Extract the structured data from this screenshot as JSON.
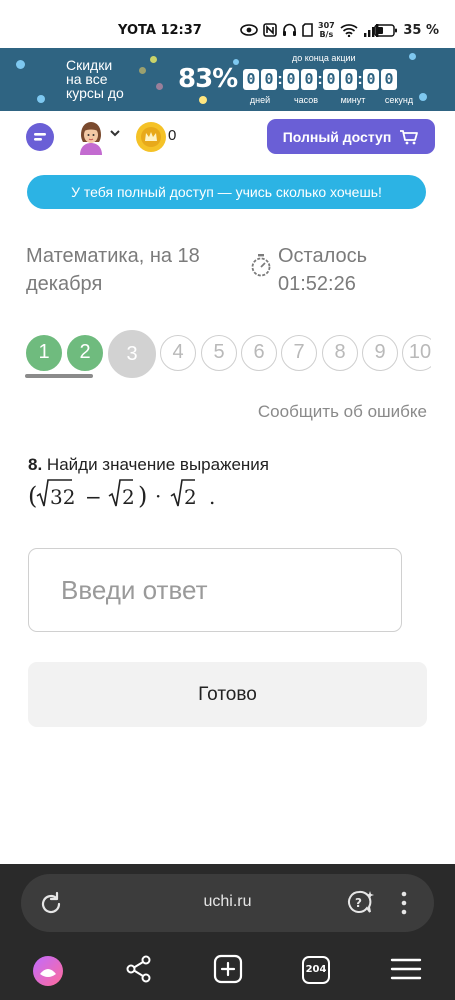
{
  "status_bar": {
    "carrier_time": "YOTA 12:37",
    "net_speed_value": "307",
    "net_speed_unit": "B/s",
    "battery": "35 %"
  },
  "promo": {
    "text_lines": [
      "Скидки",
      "на все",
      "курсы до"
    ],
    "percent": "83%",
    "until_label": "до конца акции",
    "timer": [
      {
        "digits": [
          "0",
          "0"
        ],
        "label": "дней"
      },
      {
        "digits": [
          "0",
          "0"
        ],
        "label": "часов"
      },
      {
        "digits": [
          "0",
          "0"
        ],
        "label": "минут"
      },
      {
        "digits": [
          "0",
          "0"
        ],
        "label": "секунд"
      }
    ]
  },
  "header": {
    "crown_count": "0",
    "full_access_label": "Полный доступ"
  },
  "info_message": "У тебя полный доступ — учись сколько хочешь!",
  "test": {
    "title": "Математика, на 18 декабря",
    "remaining_label": "Осталось",
    "remaining_time": "01:52:26"
  },
  "questions": [
    {
      "label": "1",
      "state": "done"
    },
    {
      "label": "2",
      "state": "done"
    },
    {
      "label": "3",
      "state": "current"
    },
    {
      "label": "4",
      "state": "pending"
    },
    {
      "label": "5",
      "state": "pending"
    },
    {
      "label": "6",
      "state": "pending"
    },
    {
      "label": "7",
      "state": "pending"
    },
    {
      "label": "8",
      "state": "pending"
    },
    {
      "label": "9",
      "state": "pending"
    },
    {
      "label": "10",
      "state": "pending"
    }
  ],
  "report_error": "Сообщить об ошибке",
  "question": {
    "number": "8.",
    "text": "Найди значение выражения",
    "formula": {
      "open_paren": "(",
      "radicand_a": "32",
      "minus": "−",
      "radicand_b": "2",
      "close_paren": ")",
      "times": "·",
      "radicand_c": "2",
      "period": "."
    }
  },
  "answer": {
    "placeholder": "Введи ответ",
    "value": ""
  },
  "done_label": "Готово",
  "browser": {
    "url": "uchi.ru",
    "tabs_count": "204"
  },
  "colors": {
    "brand_purple": "#6a5fd6",
    "info_blue": "#2cb3e4",
    "done_green": "#6fbb7e",
    "promo_bg": "#2f6482"
  }
}
